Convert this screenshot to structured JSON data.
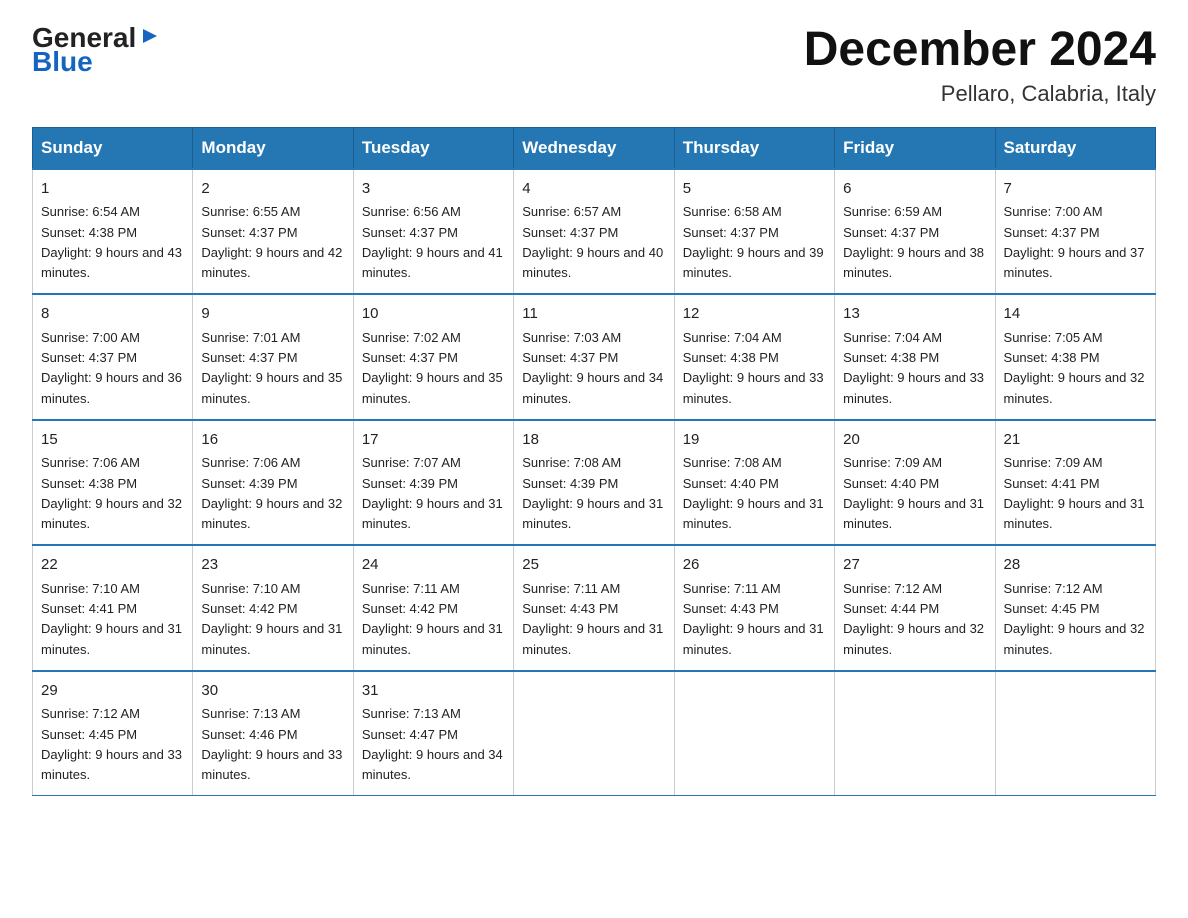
{
  "header": {
    "logo_top": "General",
    "logo_bottom": "Blue",
    "title": "December 2024",
    "subtitle": "Pellaro, Calabria, Italy"
  },
  "days": [
    "Sunday",
    "Monday",
    "Tuesday",
    "Wednesday",
    "Thursday",
    "Friday",
    "Saturday"
  ],
  "weeks": [
    [
      {
        "num": "1",
        "sunrise": "6:54 AM",
        "sunset": "4:38 PM",
        "daylight": "9 hours and 43 minutes."
      },
      {
        "num": "2",
        "sunrise": "6:55 AM",
        "sunset": "4:37 PM",
        "daylight": "9 hours and 42 minutes."
      },
      {
        "num": "3",
        "sunrise": "6:56 AM",
        "sunset": "4:37 PM",
        "daylight": "9 hours and 41 minutes."
      },
      {
        "num": "4",
        "sunrise": "6:57 AM",
        "sunset": "4:37 PM",
        "daylight": "9 hours and 40 minutes."
      },
      {
        "num": "5",
        "sunrise": "6:58 AM",
        "sunset": "4:37 PM",
        "daylight": "9 hours and 39 minutes."
      },
      {
        "num": "6",
        "sunrise": "6:59 AM",
        "sunset": "4:37 PM",
        "daylight": "9 hours and 38 minutes."
      },
      {
        "num": "7",
        "sunrise": "7:00 AM",
        "sunset": "4:37 PM",
        "daylight": "9 hours and 37 minutes."
      }
    ],
    [
      {
        "num": "8",
        "sunrise": "7:00 AM",
        "sunset": "4:37 PM",
        "daylight": "9 hours and 36 minutes."
      },
      {
        "num": "9",
        "sunrise": "7:01 AM",
        "sunset": "4:37 PM",
        "daylight": "9 hours and 35 minutes."
      },
      {
        "num": "10",
        "sunrise": "7:02 AM",
        "sunset": "4:37 PM",
        "daylight": "9 hours and 35 minutes."
      },
      {
        "num": "11",
        "sunrise": "7:03 AM",
        "sunset": "4:37 PM",
        "daylight": "9 hours and 34 minutes."
      },
      {
        "num": "12",
        "sunrise": "7:04 AM",
        "sunset": "4:38 PM",
        "daylight": "9 hours and 33 minutes."
      },
      {
        "num": "13",
        "sunrise": "7:04 AM",
        "sunset": "4:38 PM",
        "daylight": "9 hours and 33 minutes."
      },
      {
        "num": "14",
        "sunrise": "7:05 AM",
        "sunset": "4:38 PM",
        "daylight": "9 hours and 32 minutes."
      }
    ],
    [
      {
        "num": "15",
        "sunrise": "7:06 AM",
        "sunset": "4:38 PM",
        "daylight": "9 hours and 32 minutes."
      },
      {
        "num": "16",
        "sunrise": "7:06 AM",
        "sunset": "4:39 PM",
        "daylight": "9 hours and 32 minutes."
      },
      {
        "num": "17",
        "sunrise": "7:07 AM",
        "sunset": "4:39 PM",
        "daylight": "9 hours and 31 minutes."
      },
      {
        "num": "18",
        "sunrise": "7:08 AM",
        "sunset": "4:39 PM",
        "daylight": "9 hours and 31 minutes."
      },
      {
        "num": "19",
        "sunrise": "7:08 AM",
        "sunset": "4:40 PM",
        "daylight": "9 hours and 31 minutes."
      },
      {
        "num": "20",
        "sunrise": "7:09 AM",
        "sunset": "4:40 PM",
        "daylight": "9 hours and 31 minutes."
      },
      {
        "num": "21",
        "sunrise": "7:09 AM",
        "sunset": "4:41 PM",
        "daylight": "9 hours and 31 minutes."
      }
    ],
    [
      {
        "num": "22",
        "sunrise": "7:10 AM",
        "sunset": "4:41 PM",
        "daylight": "9 hours and 31 minutes."
      },
      {
        "num": "23",
        "sunrise": "7:10 AM",
        "sunset": "4:42 PM",
        "daylight": "9 hours and 31 minutes."
      },
      {
        "num": "24",
        "sunrise": "7:11 AM",
        "sunset": "4:42 PM",
        "daylight": "9 hours and 31 minutes."
      },
      {
        "num": "25",
        "sunrise": "7:11 AM",
        "sunset": "4:43 PM",
        "daylight": "9 hours and 31 minutes."
      },
      {
        "num": "26",
        "sunrise": "7:11 AM",
        "sunset": "4:43 PM",
        "daylight": "9 hours and 31 minutes."
      },
      {
        "num": "27",
        "sunrise": "7:12 AM",
        "sunset": "4:44 PM",
        "daylight": "9 hours and 32 minutes."
      },
      {
        "num": "28",
        "sunrise": "7:12 AM",
        "sunset": "4:45 PM",
        "daylight": "9 hours and 32 minutes."
      }
    ],
    [
      {
        "num": "29",
        "sunrise": "7:12 AM",
        "sunset": "4:45 PM",
        "daylight": "9 hours and 33 minutes."
      },
      {
        "num": "30",
        "sunrise": "7:13 AM",
        "sunset": "4:46 PM",
        "daylight": "9 hours and 33 minutes."
      },
      {
        "num": "31",
        "sunrise": "7:13 AM",
        "sunset": "4:47 PM",
        "daylight": "9 hours and 34 minutes."
      },
      null,
      null,
      null,
      null
    ]
  ]
}
